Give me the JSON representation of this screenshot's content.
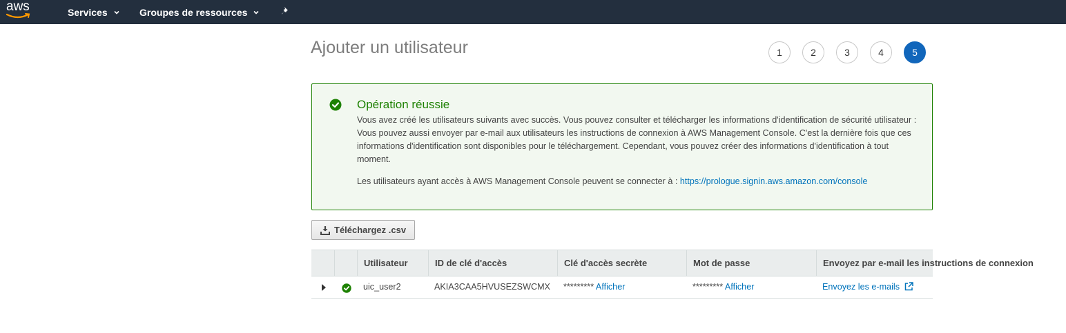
{
  "nav": {
    "logo_text": "aws",
    "services_label": "Services",
    "groups_label": "Groupes de ressources",
    "pin_icon": "pin-icon"
  },
  "page": {
    "title": "Ajouter un utilisateur",
    "steps": [
      "1",
      "2",
      "3",
      "4",
      "5"
    ],
    "active_step": "5"
  },
  "success": {
    "icon": "check-circle-icon",
    "title": "Opération réussie",
    "message": "Vous avez créé les utilisateurs suivants avec succès. Vous pouvez consulter et télécharger les informations d'identification de sécurité utilisateur : Vous pouvez aussi envoyer par e-mail aux utilisateurs les instructions de connexion à AWS Management Console. C'est la dernière fois que ces informations d'identification sont disponibles pour le téléchargement. Cependant, vous pouvez créer des informations d'identification à tout moment.",
    "console_prefix": "Les utilisateurs ayant accès à AWS Management Console peuvent se connecter à :",
    "console_url": "https://prologue.signin.aws.amazon.com/console"
  },
  "download": {
    "label": "Téléchargez .csv",
    "icon": "download-icon"
  },
  "table": {
    "headers": {
      "user": "Utilisateur",
      "access_key_id": "ID de clé d'accès",
      "secret_key": "Clé d'accès secrète",
      "password": "Mot de passe",
      "email": "Envoyez par e-mail les instructions de connexion"
    },
    "rows": [
      {
        "user": "uic_user2",
        "access_key_id": "AKIA3CAA5HVUSEZSWCMX",
        "secret_mask": "*********",
        "secret_show": "Afficher",
        "password_mask": "*********",
        "password_show": "Afficher",
        "email_link": "Envoyez les e-mails"
      }
    ]
  },
  "colors": {
    "nav_bg": "#232f3e",
    "success_green": "#1d8102",
    "link_blue": "#0073bb",
    "active_step": "#1166bb"
  }
}
